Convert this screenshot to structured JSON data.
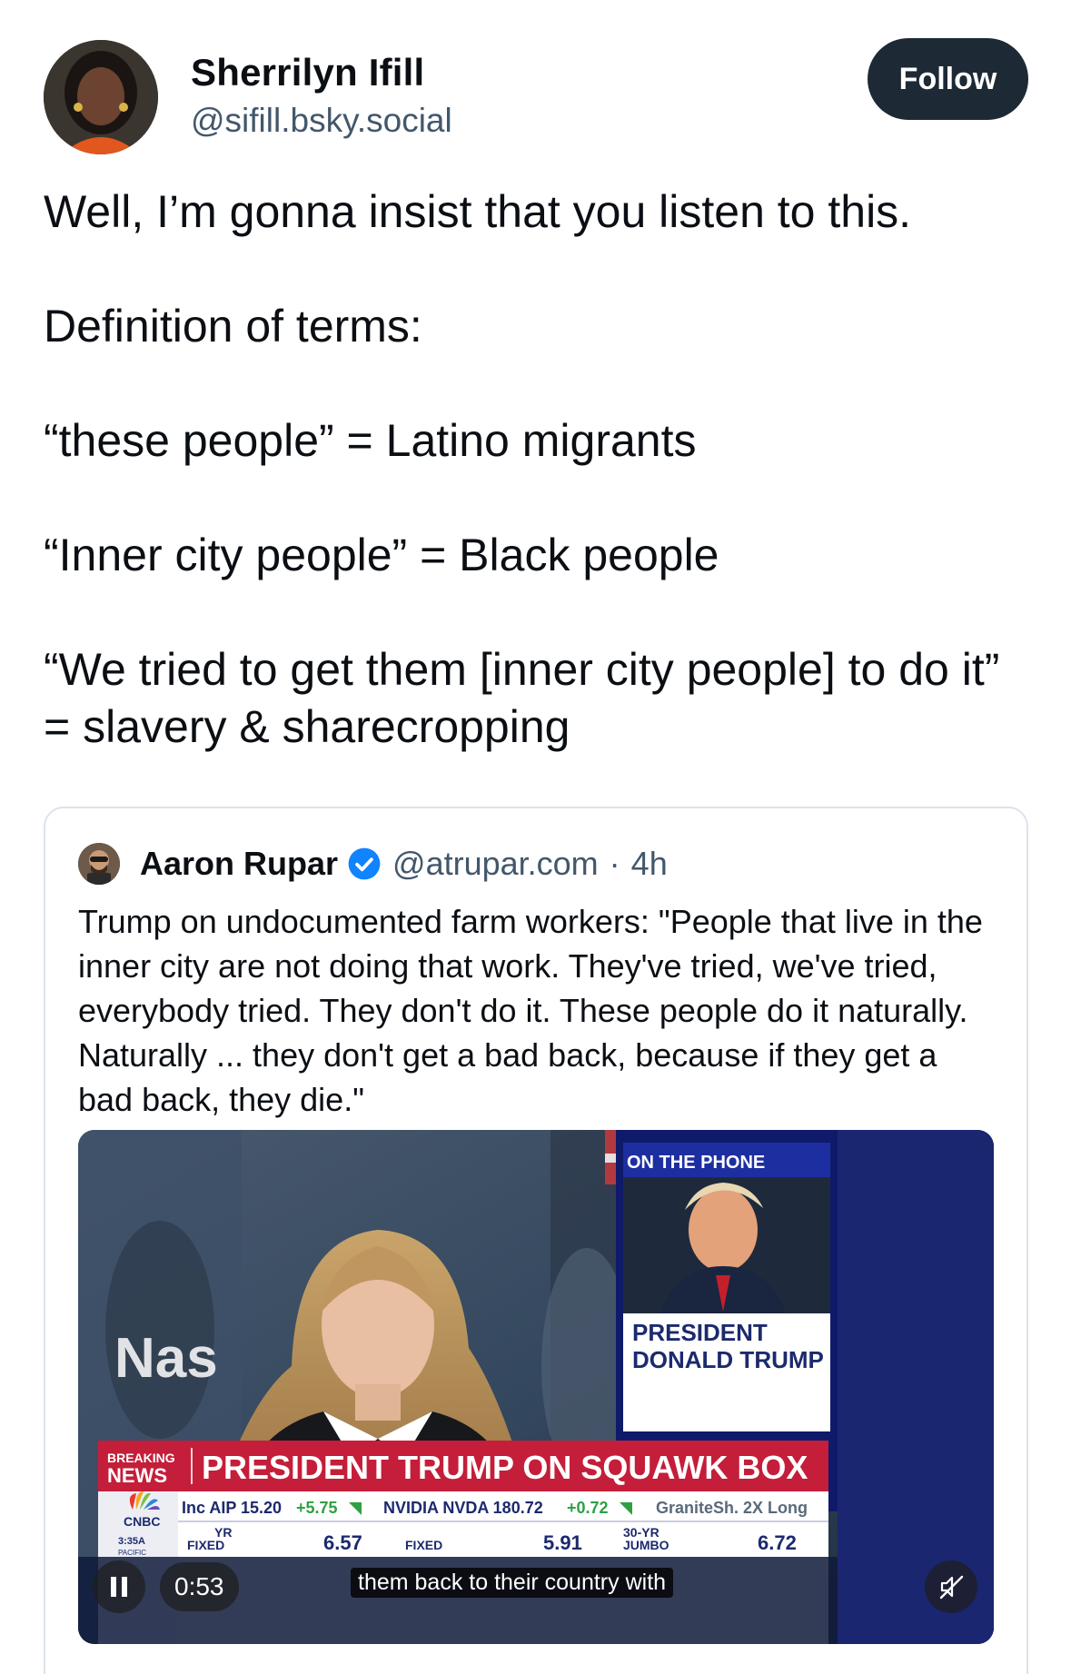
{
  "author": {
    "name": "Sherrilyn Ifill",
    "handle": "@sifill.bsky.social",
    "follow_label": "Follow"
  },
  "post": {
    "paragraphs": [
      "Well, I’m gonna insist that you listen to this.",
      "Definition of terms:",
      "“these people” = Latino migrants",
      "“Inner city people” = Black people",
      "“We tried to get them [inner city people] to do it” = slavery & sharecropping"
    ]
  },
  "quoted_post": {
    "name": "Aaron Rupar",
    "handle": "@atrupar.com",
    "separator": "·",
    "time": "4h",
    "text": "Trump on undocumented farm workers: \"People that live in the inner city are not doing that work. They've tried, we've tried, everybody tried. They don't do it. These people do it naturally. Naturally ... they don't get a bad back, because if they get a bad back, they die.\""
  },
  "video": {
    "on_the_phone": "ON THE PHONE",
    "caller_line1": "PRESIDENT",
    "caller_line2": "DONALD TRUMP",
    "breaking_line1": "BREAKING",
    "breaking_line2": "NEWS",
    "headline": "PRESIDENT TRUMP ON SQUAWK BOX",
    "backdrop_text": "Nas",
    "network": "CNBC",
    "clock": "3:35A",
    "clock_zone": "PACIFIC",
    "ticker_1": "Inc  AIP 15.20",
    "ticker_1_change": "+5.75",
    "ticker_2": "NVIDIA  NVDA 180.72",
    "ticker_2_change": "+0.72",
    "ticker_3": "GraniteSh. 2X Long",
    "rate_1_label": "YR",
    "rate_1_sub": "FIXED",
    "rate_1_value": "6.57",
    "rate_2_sub": "FIXED",
    "rate_2_value": "5.91",
    "rate_3_label": "30-YR",
    "rate_3_sub": "JUMBO",
    "rate_3_value": "6.72",
    "subtitle": "them back to their country with",
    "elapsed": "0:53",
    "is_muted": true,
    "play_state_icon": "pause-icon",
    "mute_state_icon": "muted-speaker-icon"
  },
  "colors": {
    "follow_bg": "#1e2936",
    "handle_gray": "#42576c",
    "verified_blue": "#1083fe",
    "cnbc_red": "#c41e3a",
    "cnbc_navy": "#1c2a6e",
    "ticker_green": "#2ea043"
  }
}
